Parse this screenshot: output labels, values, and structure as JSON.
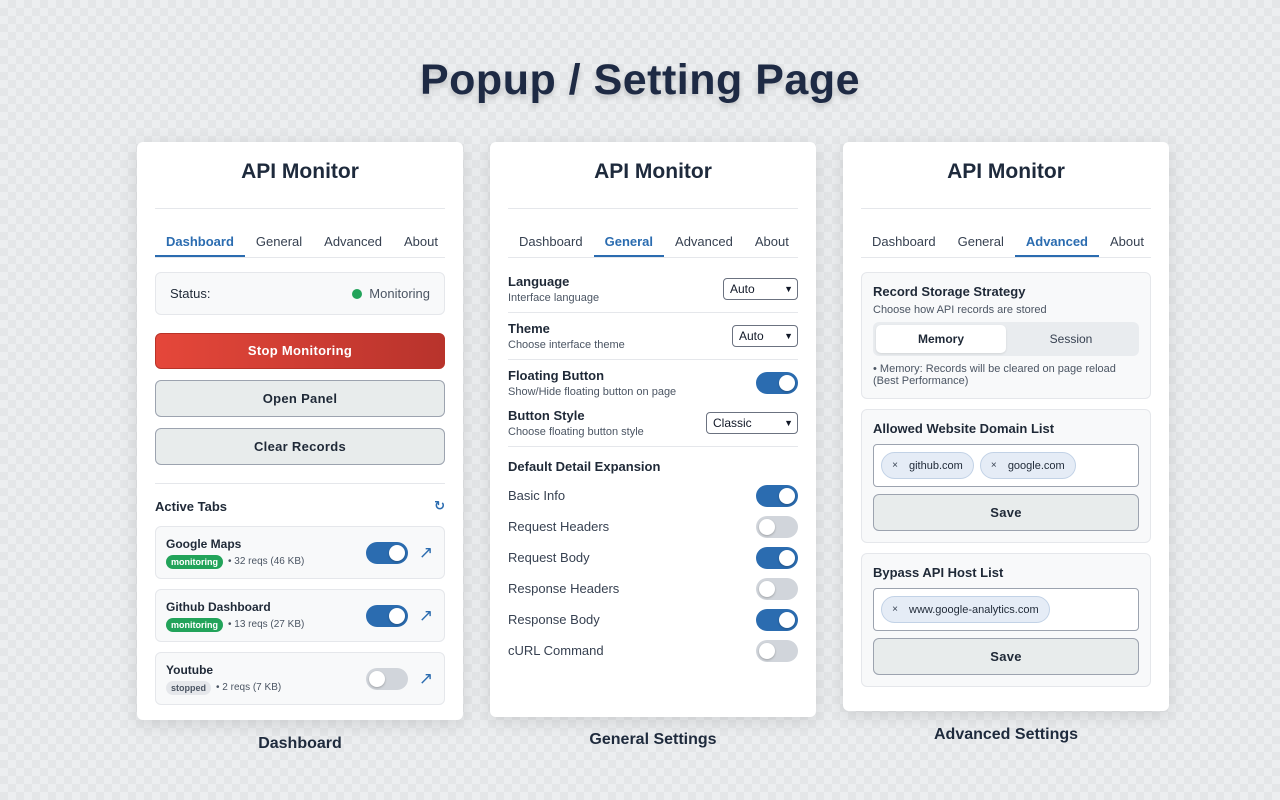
{
  "page_title": "Popup / Setting Page",
  "app_title": "API Monitor",
  "tabs": [
    "Dashboard",
    "General",
    "Advanced",
    "About"
  ],
  "dashboard": {
    "status_label": "Status:",
    "status_value": "Monitoring",
    "status_color": "#22a35a",
    "stop_button": "Stop Monitoring",
    "open_panel_button": "Open Panel",
    "clear_records_button": "Clear Records",
    "active_tabs_heading": "Active Tabs",
    "refresh_icon": "↻",
    "items": [
      {
        "name": "Google Maps",
        "badge": "monitoring",
        "meta": "• 32 reqs (46 KB)",
        "enabled": true,
        "open_icon": "↗"
      },
      {
        "name": "Github Dashboard",
        "badge": "monitoring",
        "meta": "• 13 reqs (27 KB)",
        "enabled": true,
        "open_icon": "↗"
      },
      {
        "name": "Youtube",
        "badge": "stopped",
        "meta": "• 2 reqs (7 KB)",
        "enabled": false,
        "open_icon": "↗"
      }
    ],
    "caption": "Dashboard"
  },
  "general": {
    "language": {
      "label": "Language",
      "desc": "Interface language",
      "value": "Auto"
    },
    "theme": {
      "label": "Theme",
      "desc": "Choose interface theme",
      "value": "Auto"
    },
    "floating_button": {
      "label": "Floating Button",
      "desc": "Show/Hide floating button on page",
      "enabled": true
    },
    "button_style": {
      "label": "Button Style",
      "desc": "Choose floating button style",
      "value": "Classic"
    },
    "expansion_heading": "Default Detail Expansion",
    "expansion": [
      {
        "label": "Basic Info",
        "enabled": true
      },
      {
        "label": "Request Headers",
        "enabled": false
      },
      {
        "label": "Request Body",
        "enabled": true
      },
      {
        "label": "Response Headers",
        "enabled": false
      },
      {
        "label": "Response Body",
        "enabled": true
      },
      {
        "label": "cURL Command",
        "enabled": false
      }
    ],
    "caption": "General Settings"
  },
  "advanced": {
    "storage_title": "Record Storage Strategy",
    "storage_desc": "Choose how API records are stored",
    "storage_options": [
      "Memory",
      "Session"
    ],
    "storage_selected": "Memory",
    "storage_note": "• Memory: Records will be cleared on page reload (Best Performance)",
    "allowed_title": "Allowed Website Domain List",
    "allowed_domains": [
      "github.com",
      "google.com"
    ],
    "bypass_title": "Bypass API Host List",
    "bypass_hosts": [
      "www.google-analytics.com"
    ],
    "save_label": "Save",
    "chip_remove_icon": "×",
    "caption": "Advanced Settings"
  },
  "colors": {
    "accent": "#2b6cb0",
    "danger": "#d83f33",
    "success": "#22a35a"
  }
}
